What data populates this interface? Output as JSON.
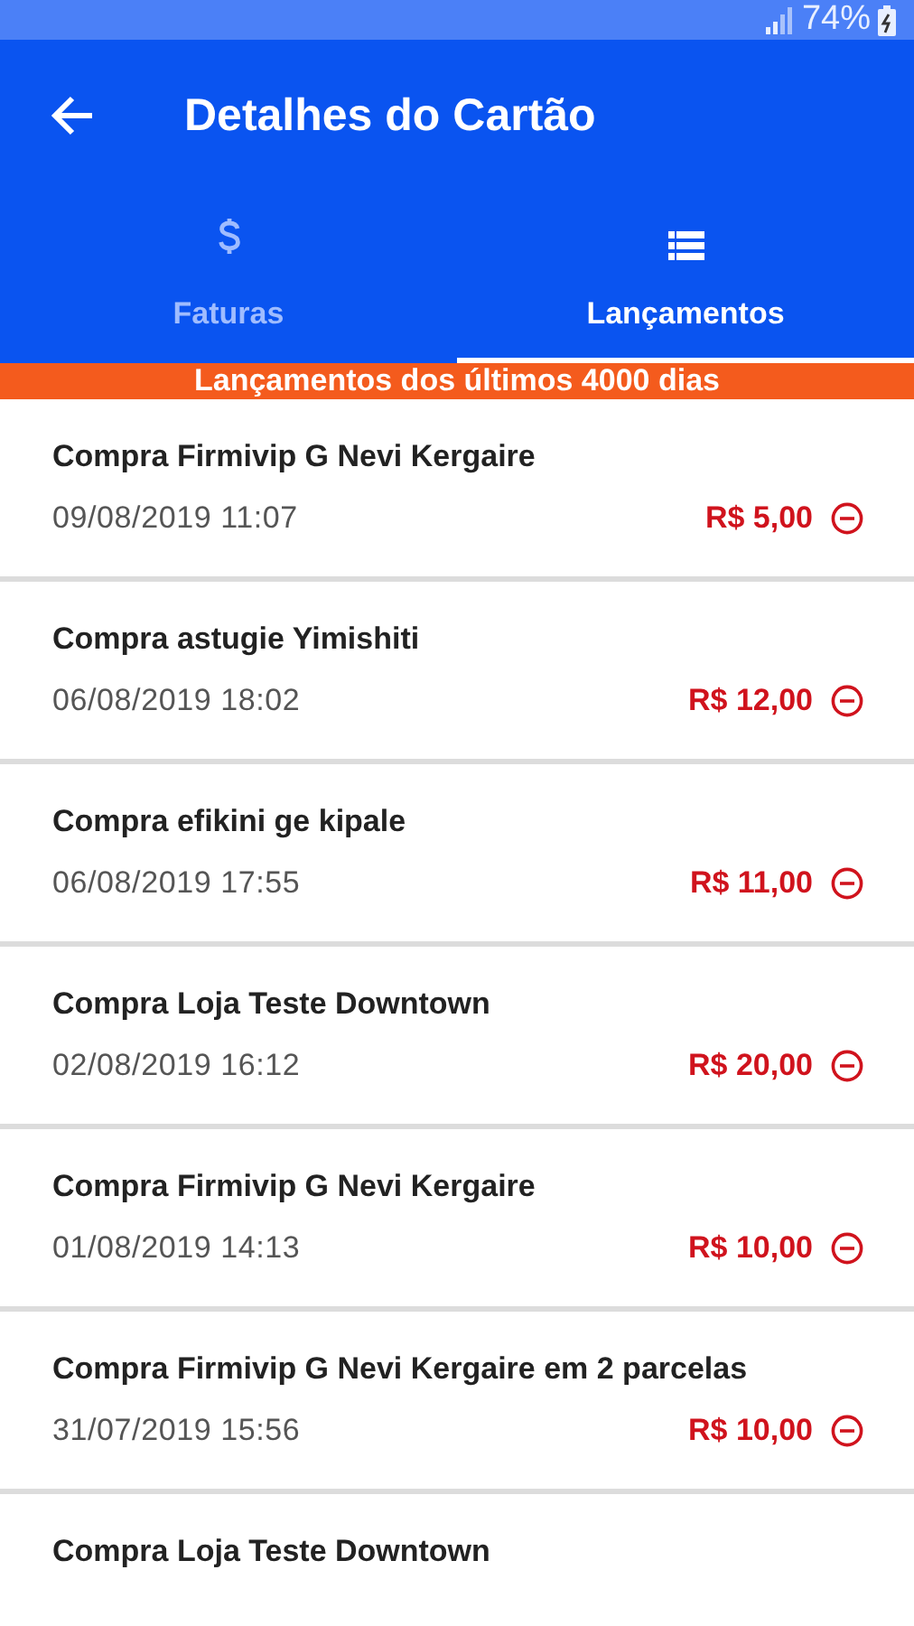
{
  "status_bar": {
    "battery": "74%"
  },
  "app_bar": {
    "title": "Detalhes do Cartão"
  },
  "tabs": [
    {
      "label": "Faturas",
      "selected": false
    },
    {
      "label": "Lançamentos",
      "selected": true
    }
  ],
  "banner": "Lançamentos dos últimos 4000 dias",
  "transactions": [
    {
      "description": "Compra Firmivip G Nevi Kergaire",
      "date": "09/08/2019 11:07",
      "amount": "R$ 5,00"
    },
    {
      "description": "Compra astugie Yimishiti",
      "date": "06/08/2019 18:02",
      "amount": "R$ 12,00"
    },
    {
      "description": "Compra efikini ge kipale",
      "date": "06/08/2019 17:55",
      "amount": "R$ 11,00"
    },
    {
      "description": "Compra Loja Teste Downtown",
      "date": "02/08/2019 16:12",
      "amount": "R$ 20,00"
    },
    {
      "description": "Compra Firmivip G Nevi Kergaire",
      "date": "01/08/2019 14:13",
      "amount": "R$ 10,00"
    },
    {
      "description": "Compra Firmivip G Nevi Kergaire em 2 parcelas",
      "date": "31/07/2019 15:56",
      "amount": "R$ 10,00"
    },
    {
      "description": "Compra Loja Teste Downtown"
    }
  ]
}
